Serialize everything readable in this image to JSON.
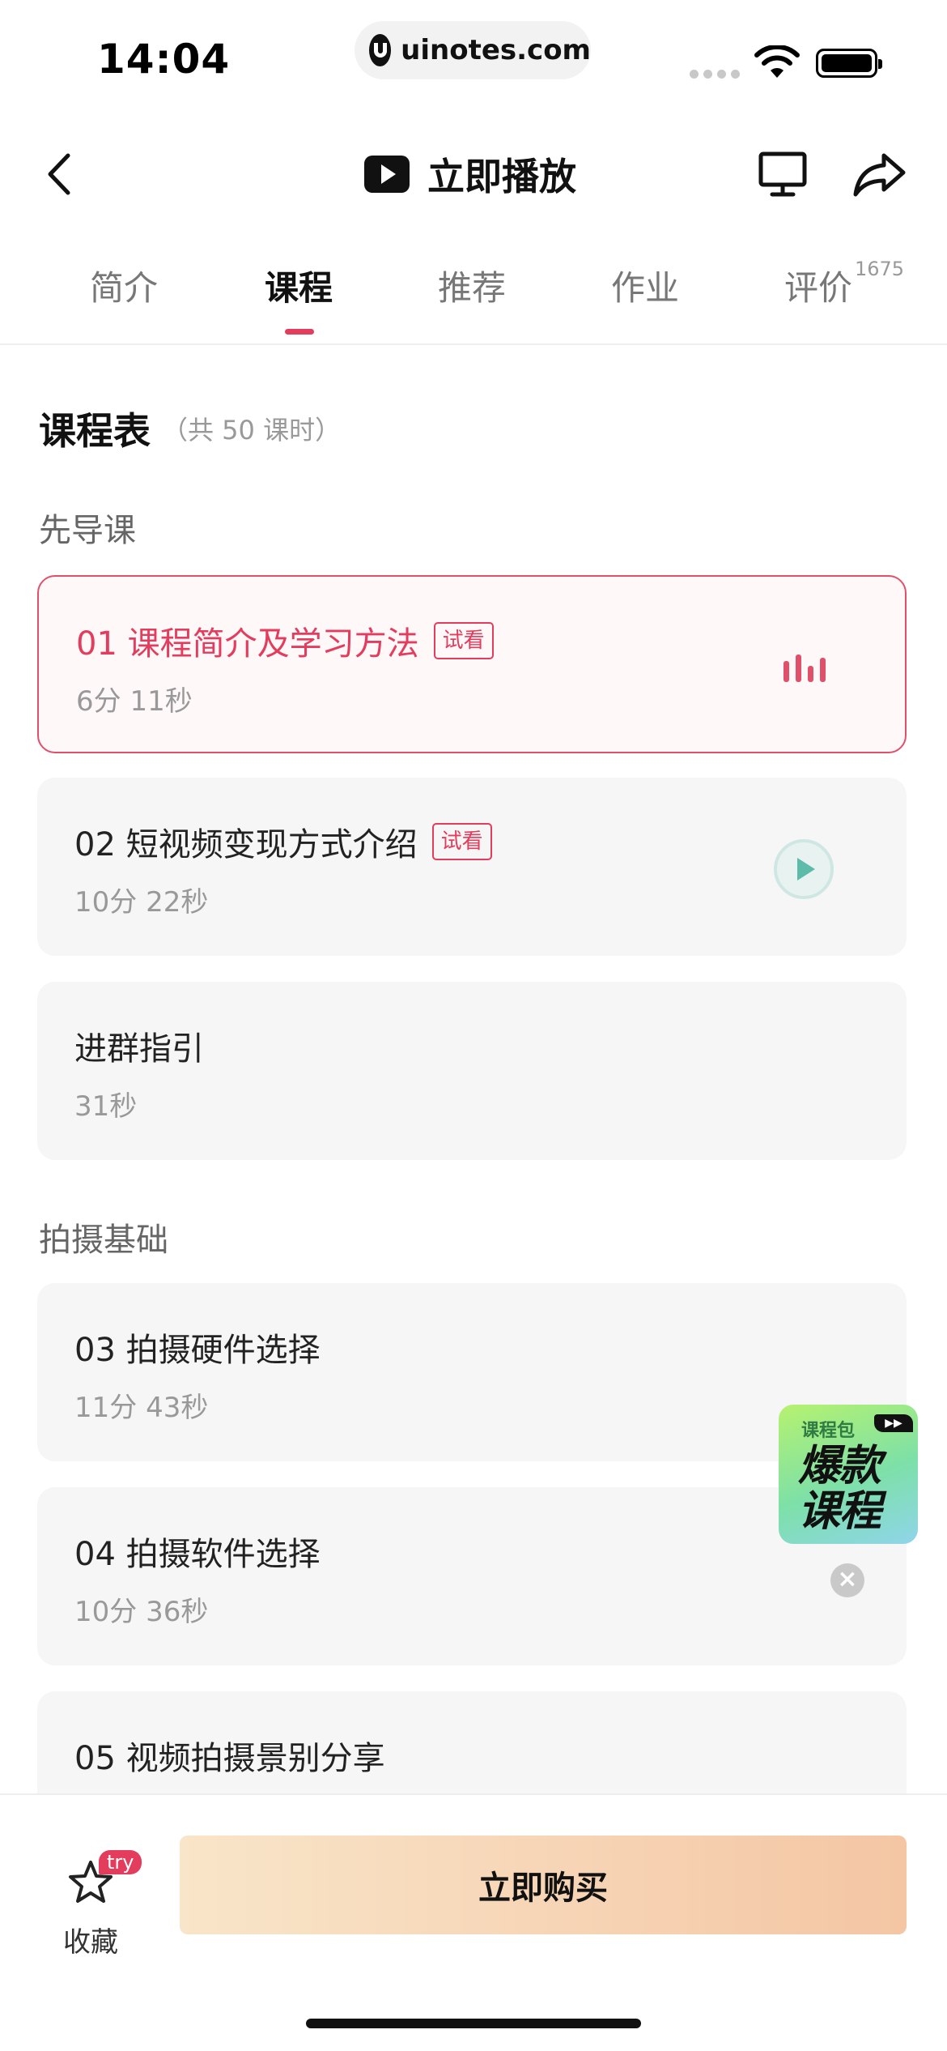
{
  "status_bar": {
    "time": "14:04",
    "url": "uinotes.com"
  },
  "nav": {
    "title": "立即播放"
  },
  "tabs": {
    "items": [
      {
        "label": "简介"
      },
      {
        "label": "课程"
      },
      {
        "label": "推荐"
      },
      {
        "label": "作业"
      },
      {
        "label": "评价"
      }
    ],
    "active": "课程",
    "review_count": "1675"
  },
  "schedule": {
    "title": "课程表",
    "count": "（共 50 课时）"
  },
  "sections": [
    {
      "title": "先导课",
      "lessons": [
        {
          "title": "01 课程简介及学习方法",
          "tag": "试看",
          "duration": "6分 11秒",
          "state": "playing"
        },
        {
          "title": "02 短视频变现方式介绍",
          "tag": "试看",
          "duration": "10分 22秒",
          "state": "play"
        },
        {
          "title": "进群指引",
          "duration": "31秒"
        }
      ]
    },
    {
      "title": "拍摄基础",
      "lessons": [
        {
          "title": "03 拍摄硬件选择",
          "duration": "11分 43秒"
        },
        {
          "title": "04 拍摄软件选择",
          "duration": "10分 36秒"
        },
        {
          "title": "05 视频拍摄景别分享"
        }
      ]
    }
  ],
  "promo": {
    "tag": "课程包",
    "line1": "爆款",
    "line2": "课程"
  },
  "bottom": {
    "fav_label": "收藏",
    "fav_badge": "try",
    "buy_label": "立即购买"
  },
  "colors": {
    "accent": "#e33c5c",
    "play_teal": "#5dbba9",
    "card_bg": "#f6f6f6"
  }
}
